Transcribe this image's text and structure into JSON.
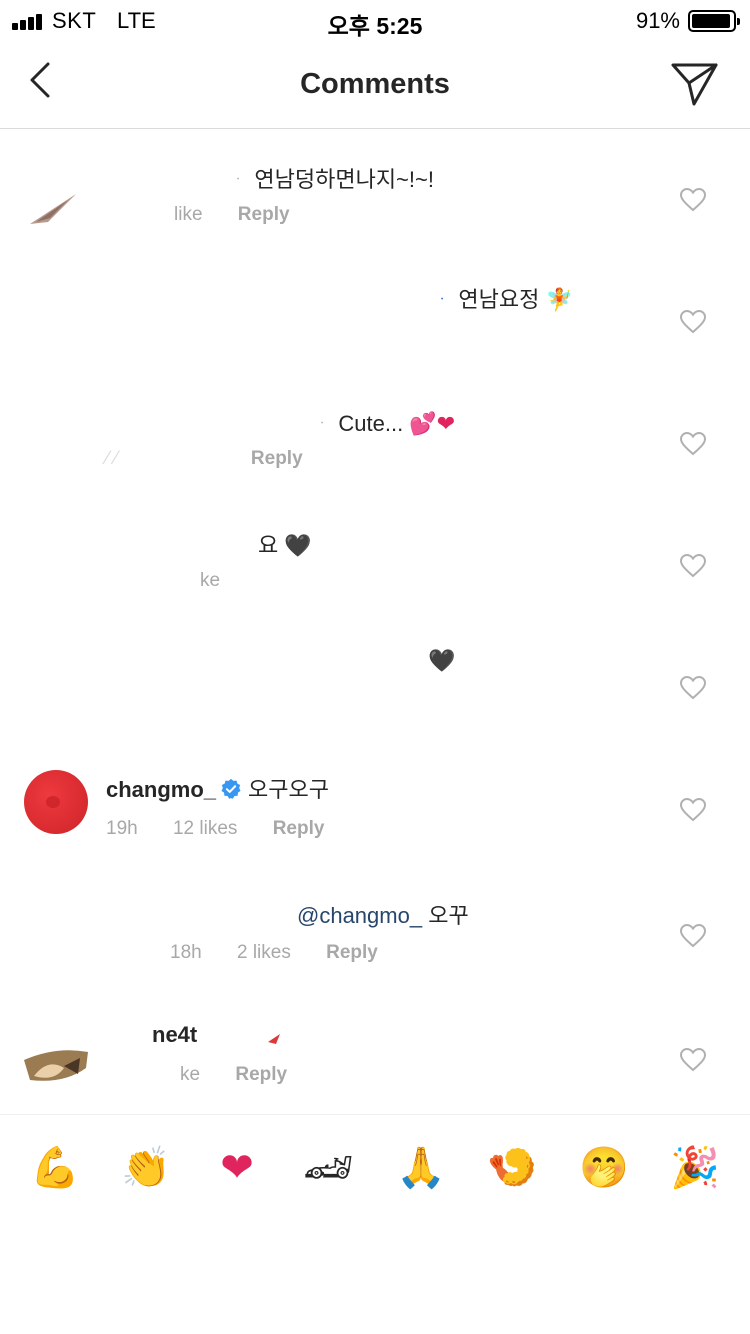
{
  "status_bar": {
    "carrier": "SKT",
    "network": "LTE",
    "time": "오후 5:25",
    "battery_percent": "91%"
  },
  "nav": {
    "title": "Comments",
    "back_icon": "chevron-left-icon",
    "share_icon": "paper-plane-icon"
  },
  "comments": [
    {
      "text": "연남덩하면나지~!~!",
      "meta_likes": "like",
      "meta_reply": "Reply"
    },
    {
      "text": "연남요정",
      "emoji": "🧚"
    },
    {
      "text": "Cute...",
      "emoji": "💕❤",
      "meta_reply": "Reply"
    },
    {
      "text": "요",
      "emoji": "🖤",
      "meta_likes": "ke"
    },
    {
      "emoji": "🖤"
    },
    {
      "username": "changmo_",
      "verified": true,
      "text": "오구오구",
      "time": "19h",
      "likes": "12 likes",
      "reply": "Reply"
    },
    {
      "mention": "@changmo_",
      "text": "오꾸",
      "time": "18h",
      "likes": "2 likes",
      "reply": "Reply"
    },
    {
      "username": "ne4t",
      "meta_likes": "ke",
      "meta_reply": "Reply"
    }
  ],
  "emoji_bar": [
    {
      "glyph": "💪",
      "name": "flexed-biceps-emoji"
    },
    {
      "glyph": "👏",
      "name": "clapping-hands-emoji"
    },
    {
      "glyph": "❤",
      "name": "red-heart-emoji"
    },
    {
      "glyph": "🏎",
      "name": "racing-car-emoji"
    },
    {
      "glyph": "🙏",
      "name": "folded-hands-emoji"
    },
    {
      "glyph": "🍤",
      "name": "fried-shrimp-emoji"
    },
    {
      "glyph": "🤭",
      "name": "face-with-hand-emoji"
    },
    {
      "glyph": "🎉",
      "name": "party-popper-emoji"
    }
  ],
  "colors": {
    "text": "#262626",
    "meta": "#a8a8a8",
    "mention": "#27466b",
    "verified": "#3897f0",
    "divider": "#dbdbdb"
  }
}
